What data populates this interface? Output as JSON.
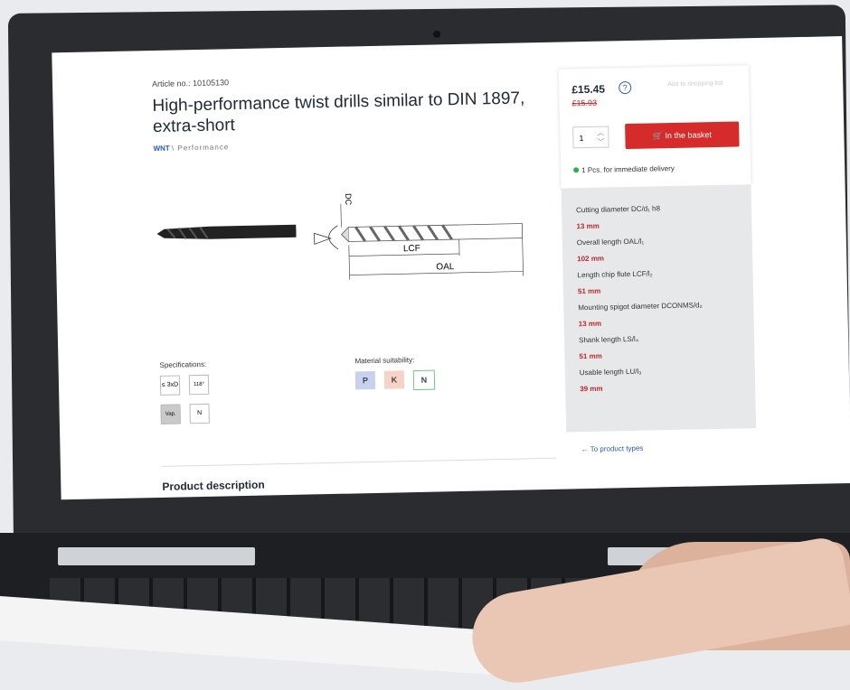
{
  "product": {
    "article": "Article no.: 10105130",
    "title": "High-performance twist drills similar to DIN 1897, extra-short",
    "brand": "WNT",
    "brand_line": "\\ Performance"
  },
  "diagram": {
    "dc": "DC",
    "lcf": "LCF",
    "oal": "OAL"
  },
  "specs": {
    "label": "Specifications:",
    "items": [
      "≤ 3xD",
      "118°",
      "Vap.",
      "N"
    ]
  },
  "materials": {
    "label": "Material suitability:",
    "items": [
      {
        "code": "P",
        "color": "#c8d2ee"
      },
      {
        "code": "K",
        "color": "#f6d3c6"
      },
      {
        "code": "N",
        "color": "#ffffff"
      }
    ]
  },
  "description_heading": "Product description",
  "purchase": {
    "price": "£15.45",
    "help": "?",
    "old_price": "£15.93",
    "list_link": "Add to shopping list",
    "quantity": "1",
    "basket_label": "In the basket",
    "availability": "1 Pcs. for immediate delivery"
  },
  "properties": [
    {
      "label": "Cutting diameter DC/d₁ h8",
      "value": "13 mm"
    },
    {
      "label": "Overall length OAL/l₁",
      "value": "102 mm"
    },
    {
      "label": "Length chip flute LCF/l₂",
      "value": "51 mm"
    },
    {
      "label": "Mounting spigot diameter DCONMS/d₂",
      "value": "13 mm"
    },
    {
      "label": "Shank length LS/l₄",
      "value": "51 mm"
    },
    {
      "label": "Usable length LU/l₃",
      "value": "39 mm"
    }
  ],
  "back_link": "←  To product types",
  "colors": {
    "accent_red": "#d52b2b",
    "brand_blue": "#2a5caa",
    "available_green": "#2fae4a"
  }
}
